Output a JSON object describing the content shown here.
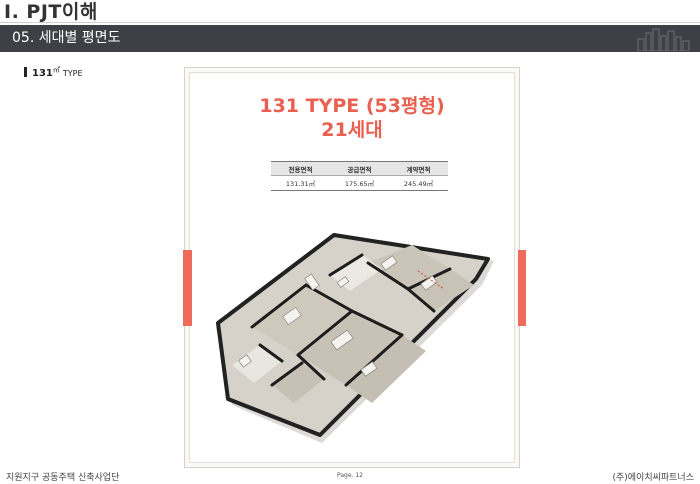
{
  "header": {
    "chapter_title": "I. PJT이해",
    "section_label": "05. 세대별 평면도"
  },
  "subhead": {
    "number": "131",
    "unit": "㎡",
    "type_word": "TYPE"
  },
  "plan": {
    "title_line1": "131 TYPE (53평형)",
    "title_line2": "21세대",
    "table": {
      "headers": [
        "전용면적",
        "공급면적",
        "계약면적"
      ],
      "values": [
        "131.31㎡",
        "175.65㎡",
        "245.49㎡"
      ]
    }
  },
  "footer": {
    "left": "지원지구 공동주택 신축사업단",
    "page": "Page. 12",
    "right": "(주)에이치씨파트너스"
  },
  "colors": {
    "accent": "#ee6b5b",
    "title": "#e8604f",
    "section_bar": "#3d4145"
  }
}
